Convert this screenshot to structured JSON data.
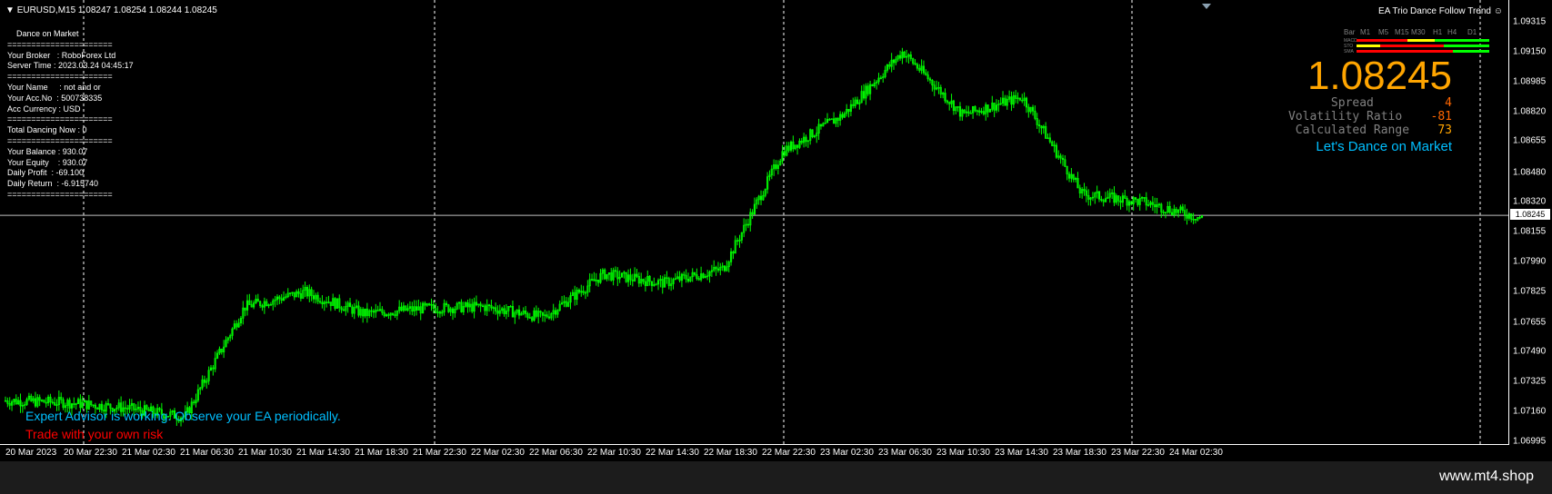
{
  "header": {
    "symbol_info": "EURUSD,M15  1.08247 1.08254 1.08244 1.08245",
    "ea_name": "EA Trio Dance Follow Trend"
  },
  "info_panel": [
    "Dance on Market",
    "======================",
    "Your Broker   : RoboForex Ltd",
    "Server Time : 2023.03.24 04:45:17",
    "======================",
    "Your Name     : not and or",
    "Your Acc.No  : 500738335",
    "Acc Currency : USD",
    "======================",
    "Total Dancing Now : 0",
    "======================",
    "Your Balance : 930.07",
    "Your Equity    : 930.07",
    "Daily Profit  : -69.100",
    "Daily Return  : -6.915740",
    "======================"
  ],
  "timeframes": [
    "Bar",
    "M1",
    "M5",
    "M15",
    "M30",
    "H1",
    "H4",
    "D1"
  ],
  "indicators": [
    "MACD",
    "STO",
    "SMA"
  ],
  "big_price": "1.08245",
  "stats": [
    {
      "label": "Spread",
      "value": "4"
    },
    {
      "label": "Volatility Ratio",
      "value": "-81"
    },
    {
      "label": "Calculated Range",
      "value": "73"
    }
  ],
  "tagline": "Let's Dance on Market",
  "messages": {
    "working": "Expert Advisor is working. Observe your EA periodically.",
    "risk": "Trade with your own risk"
  },
  "price_axis": [
    "1.09315",
    "1.09150",
    "1.08985",
    "1.08820",
    "1.08655",
    "1.08480",
    "1.08320",
    "1.08155",
    "1.07990",
    "1.07825",
    "1.07655",
    "1.07490",
    "1.07325",
    "1.07160",
    "1.06995"
  ],
  "current_price_tag": "1.08245",
  "time_axis": [
    "20 Mar 2023",
    "20 Mar 22:30",
    "21 Mar 02:30",
    "21 Mar 06:30",
    "21 Mar 10:30",
    "21 Mar 14:30",
    "21 Mar 18:30",
    "21 Mar 22:30",
    "22 Mar 02:30",
    "22 Mar 06:30",
    "22 Mar 10:30",
    "22 Mar 14:30",
    "22 Mar 18:30",
    "22 Mar 22:30",
    "23 Mar 02:30",
    "23 Mar 06:30",
    "23 Mar 10:30",
    "23 Mar 14:30",
    "23 Mar 18:30",
    "23 Mar 22:30",
    "24 Mar 02:30"
  ],
  "footer": "www.mt4.shop",
  "colors": {
    "background": "#000000",
    "candles": "#00ff00",
    "price_big": "#ffa500",
    "stat_value": "#ff6600",
    "tagline": "#00bfff",
    "risk": "#ff0000",
    "footer_bg": "#1c1c1c"
  },
  "chart_data": {
    "type": "line",
    "symbol": "EURUSD",
    "timeframe": "M15",
    "ylim": [
      1.06995,
      1.09315
    ],
    "x": [
      "20 Mar 2023",
      "20 Mar 22:30",
      "21 Mar 02:30",
      "21 Mar 06:30",
      "21 Mar 10:30",
      "21 Mar 14:30",
      "21 Mar 18:30",
      "21 Mar 22:30",
      "22 Mar 02:30",
      "22 Mar 06:30",
      "22 Mar 10:30",
      "22 Mar 14:30",
      "22 Mar 18:30",
      "22 Mar 22:30",
      "23 Mar 02:30",
      "23 Mar 06:30",
      "23 Mar 10:30",
      "23 Mar 14:30",
      "23 Mar 18:30",
      "23 Mar 22:30",
      "24 Mar 02:30"
    ],
    "series": [
      {
        "values": [
          1.0722,
          1.0721,
          1.0718,
          1.0713,
          1.0774,
          1.0782,
          1.077,
          1.0773,
          1.0774,
          1.0768,
          1.0792,
          1.0787,
          1.0795,
          1.086,
          1.088,
          1.0915,
          1.088,
          1.089,
          1.0836,
          1.0832,
          1.0823
        ]
      }
    ]
  }
}
